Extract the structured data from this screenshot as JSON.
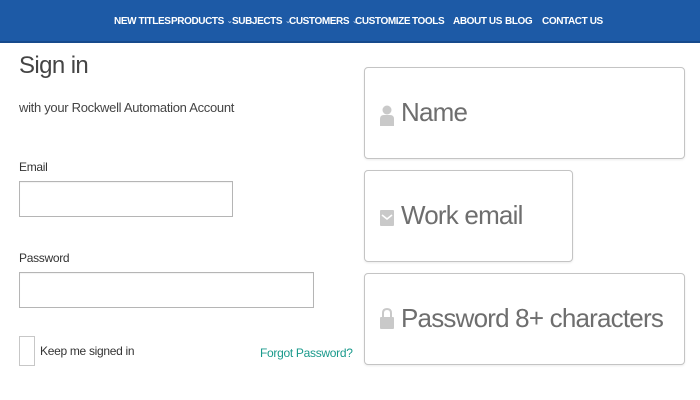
{
  "nav": {
    "items": [
      {
        "label": "NEW TITLES",
        "has_caret": false
      },
      {
        "label": "PRODUCTS",
        "has_caret": true
      },
      {
        "label": "SUBJECTS",
        "has_caret": true
      },
      {
        "label": "CUSTOMERS",
        "has_caret": true
      },
      {
        "label": "CUSTOMIZE",
        "has_caret": false
      },
      {
        "label": "TOOLS",
        "has_caret": false
      },
      {
        "label": "ABOUT US",
        "has_caret": false
      },
      {
        "label": "BLOG",
        "has_caret": false
      },
      {
        "label": "CONTACT US",
        "has_caret": false
      }
    ],
    "caret": "⌄",
    "background": "#1d5aa6"
  },
  "signin": {
    "title": "Sign in",
    "subtitle": "with your Rockwell Automation Account",
    "email_label": "Email",
    "email_value": "",
    "password_label": "Password",
    "password_value": "",
    "keep_signed_in": "Keep me signed in",
    "keep_signed_in_checked": false,
    "forgot_password": "Forgot Password?",
    "link_color": "#1a9a8c"
  },
  "register": {
    "name_placeholder": "Name",
    "name_icon": "person-icon",
    "work_email_placeholder": "Work email",
    "work_email_icon": "envelope-icon",
    "password_placeholder": "Password 8+ characters",
    "password_icon": "lock-icon"
  }
}
